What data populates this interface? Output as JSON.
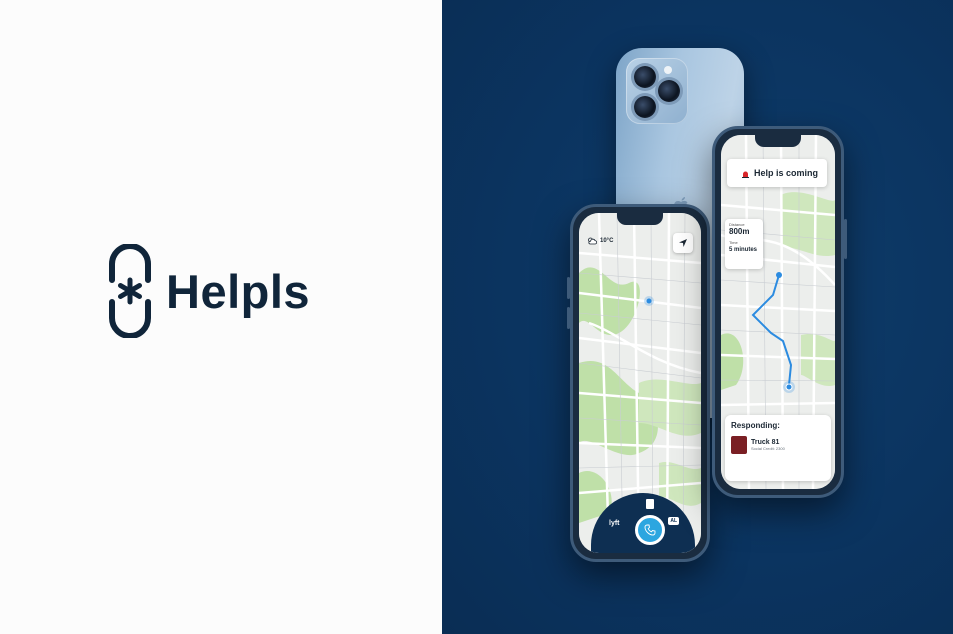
{
  "brand": {
    "name": "Helpls",
    "mark_icon": "asterisk-link-icon",
    "text_color": "#10253a"
  },
  "background": {
    "left_color": "#fcfcfc",
    "right_color": "#0b3460"
  },
  "phone_left": {
    "weather_icon": "cloud-sun-icon",
    "temperature": "10°C",
    "location_icon": "navigation-arrow-icon",
    "dock": {
      "lyft_label": "lyft",
      "call_icon": "phone-icon",
      "right_badge": "AL"
    }
  },
  "phone_right": {
    "alert_icon": "siren-icon",
    "status_title": "Help is coming",
    "distance_label": "Distance",
    "distance_value": "800m",
    "time_label": "Time",
    "time_value": "5 minutes",
    "responding_title": "Responding:",
    "unit_name": "Truck 81",
    "unit_sub": "Social Credit: 2300"
  }
}
